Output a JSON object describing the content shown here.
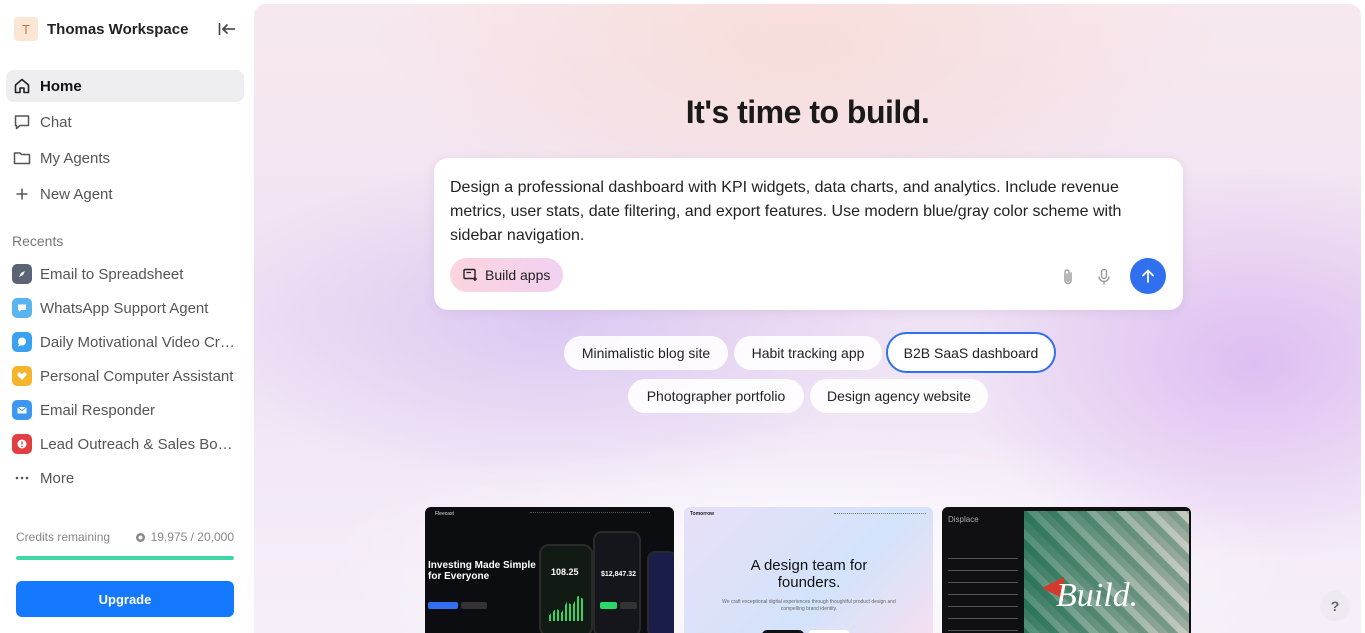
{
  "workspace": {
    "initial": "T",
    "name": "Thomas Workspace"
  },
  "nav": [
    {
      "label": "Home",
      "icon": "home-icon",
      "active": true
    },
    {
      "label": "Chat",
      "icon": "chat-icon"
    },
    {
      "label": "My Agents",
      "icon": "folder-icon"
    },
    {
      "label": "New Agent",
      "icon": "plus-icon"
    }
  ],
  "recents": {
    "heading": "Recents",
    "items": [
      {
        "label": "Email to Spreadsheet",
        "icon": "compass-icon",
        "color": "#5a6475"
      },
      {
        "label": "WhatsApp Support Agent",
        "icon": "chat-bubble-icon",
        "color": "#5ab4f0"
      },
      {
        "label": "Daily Motivational Video Creator",
        "icon": "chat-bubble-icon",
        "color": "#3aa0f0"
      },
      {
        "label": "Personal Computer Assistant",
        "icon": "heart-icon",
        "color": "#f5b52a"
      },
      {
        "label": "Email Responder",
        "icon": "mail-icon",
        "color": "#3d97f0"
      },
      {
        "label": "Lead Outreach & Sales Booking Agent",
        "icon": "alert-icon",
        "color": "#e24040"
      }
    ],
    "more_label": "More"
  },
  "credits": {
    "label": "Credits remaining",
    "value": "19,975 / 20,000",
    "fraction": 0.99875
  },
  "upgrade_label": "Upgrade",
  "main": {
    "title": "It's time to build.",
    "prompt": "Design a professional dashboard with KPI widgets, data charts, and analytics. Include revenue metrics, user stats, date filtering, and export features. Use modern blue/gray color scheme with sidebar navigation.",
    "build_label": "Build apps",
    "suggestions": [
      "Minimalistic blog site",
      "Habit tracking app",
      "B2B SaaS dashboard",
      "Photographer portfolio",
      "Design agency website"
    ],
    "selected_suggestion": "B2B SaaS dashboard",
    "accent": "#2f6ff0"
  },
  "templates": {
    "t1": {
      "brand": "Fleecast",
      "headline": "Investing Made Simple for Everyone",
      "amount": "$12,847.32",
      "stat": "108.25"
    },
    "t2": {
      "brand": "Tomorrow",
      "headline": "A design team for founders.",
      "sub": "We craft exceptional digital experiences through thoughtful product design and compelling brand identity."
    },
    "t3": {
      "brand": "Displace",
      "headline": "Build."
    }
  },
  "help_label": "?"
}
